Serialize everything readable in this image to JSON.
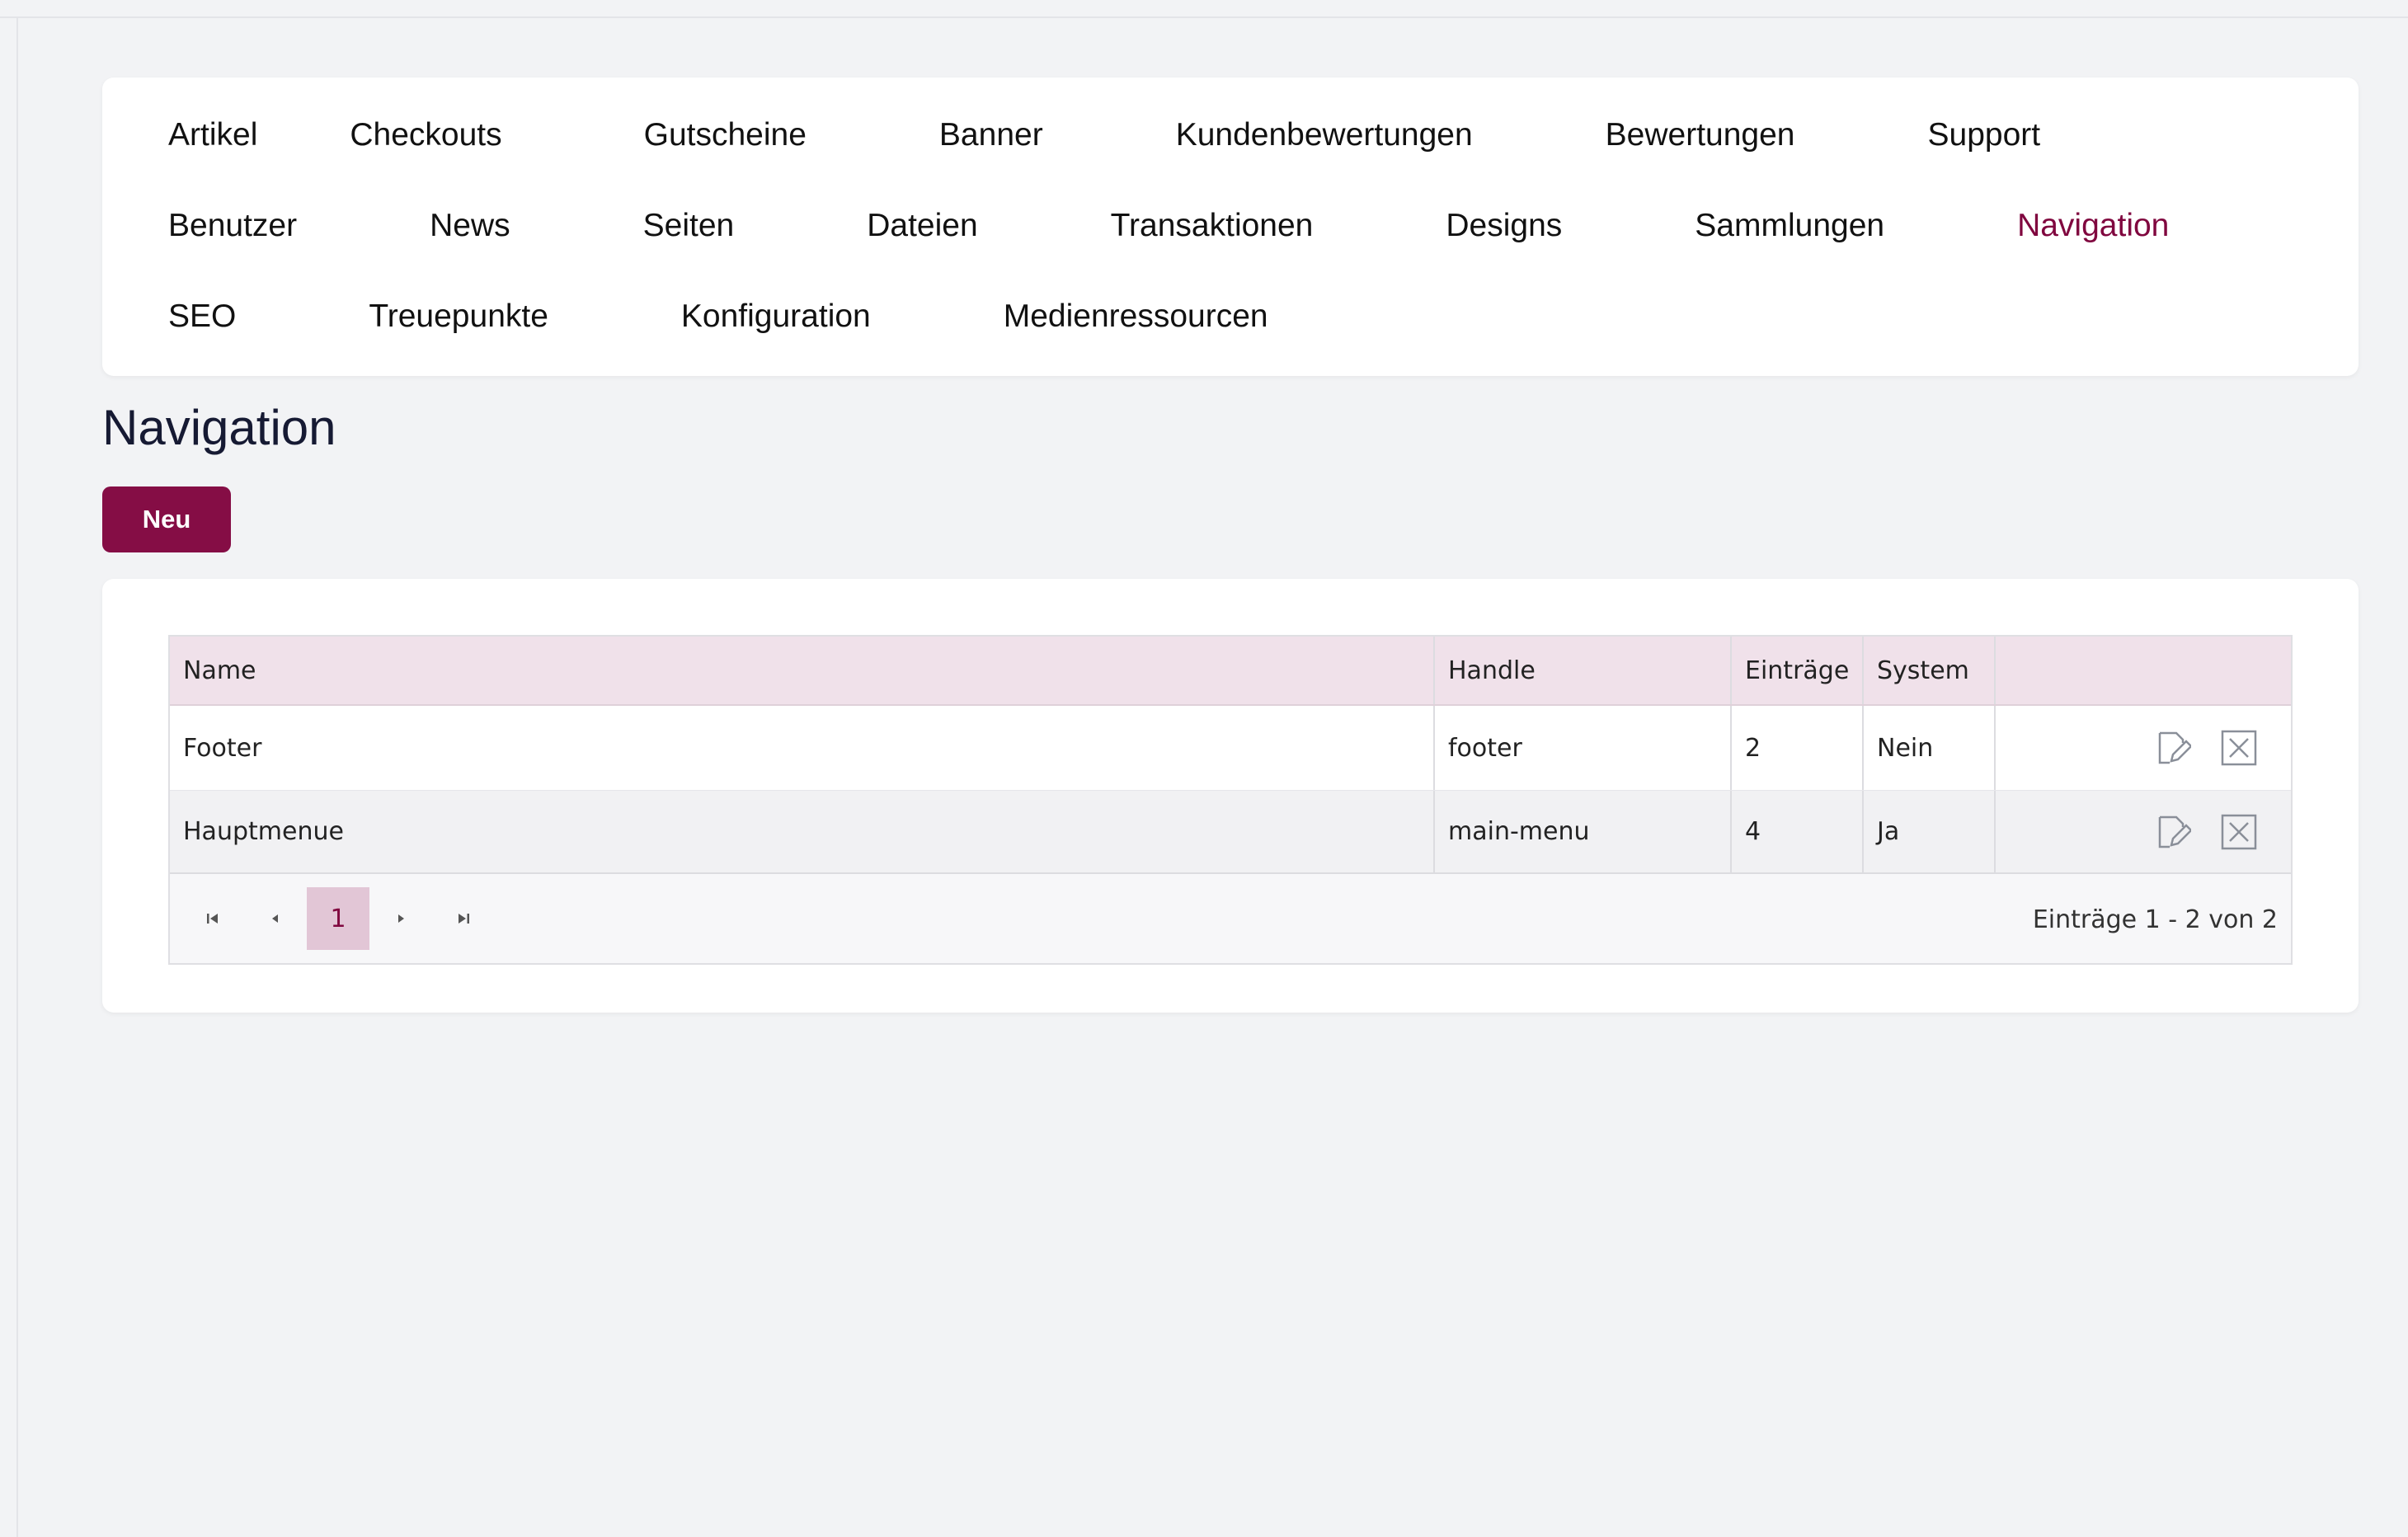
{
  "nav": {
    "row1": [
      "Artikel",
      "Checkouts",
      "Gutscheine",
      "Banner",
      "Kundenbewertungen",
      "Bewertungen",
      "Support"
    ],
    "row2": [
      "Benutzer",
      "News",
      "Seiten",
      "Dateien",
      "Transaktionen",
      "Designs",
      "Sammlungen",
      "Navigation"
    ],
    "row3": [
      "SEO",
      "Treuepunkte",
      "Konfiguration",
      "Medienressourcen"
    ],
    "active": "Navigation"
  },
  "page": {
    "title": "Navigation",
    "new_button": "Neu"
  },
  "table": {
    "headers": {
      "name": "Name",
      "handle": "Handle",
      "count": "Einträge",
      "system": "System"
    },
    "rows": [
      {
        "name": "Footer",
        "handle": "footer",
        "count": "2",
        "system": "Nein"
      },
      {
        "name": "Hauptmenue",
        "handle": "main-menu",
        "count": "4",
        "system": "Ja"
      }
    ],
    "row_actions": [
      "edit-icon",
      "delete-icon"
    ]
  },
  "pager": {
    "current_page": "1",
    "info": "Einträge 1 - 2 von 2"
  },
  "colors": {
    "accent": "#850d45",
    "active_nav": "#80073f",
    "header_bg": "#f0e1ea",
    "current_page_bg": "#e2c6d6"
  }
}
